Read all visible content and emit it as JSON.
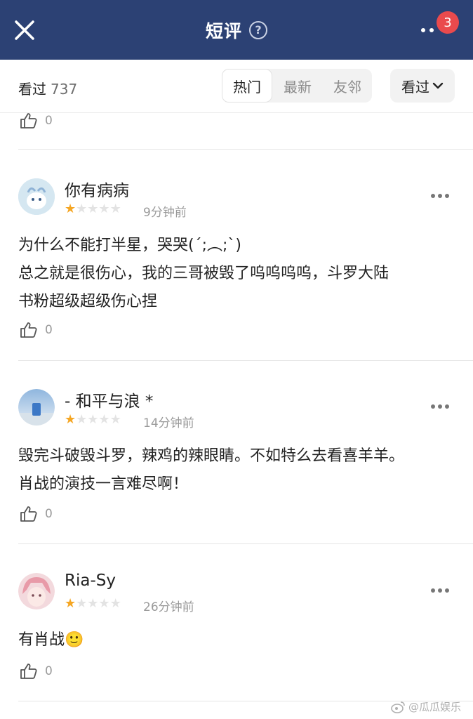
{
  "header": {
    "title": "短评",
    "help_icon": "question-circle-icon",
    "close_icon": "close-icon",
    "more_icon": "more-dots-icon",
    "badge_count": "3",
    "bar_color": "#2c4174",
    "badge_color": "#ea4a4d"
  },
  "filter": {
    "watched_label": "看过",
    "watched_count": "737",
    "tabs": [
      {
        "label": "热门",
        "active": true
      },
      {
        "label": "最新",
        "active": false
      },
      {
        "label": "友邻",
        "active": false
      }
    ],
    "dropdown_label": "看过"
  },
  "top_partial": {
    "like_count": "0"
  },
  "reviews": [
    {
      "username": "你有病病",
      "rating": 1,
      "max_rating": 5,
      "time": "9分钟前",
      "lines": [
        "为什么不能打半星，哭哭(´;︵;`)",
        "总之就是很伤心，我的三哥被毁了呜呜呜呜，斗罗大陆",
        "书粉超级超级伤心捏"
      ],
      "like_count": "0"
    },
    {
      "username": "- 和平与浪 *",
      "rating": 1,
      "max_rating": 5,
      "time": "14分钟前",
      "lines": [
        "毁完斗破毁斗罗，辣鸡的辣眼睛。不如特么去看喜羊羊。",
        "肖战的演技一言难尽啊！"
      ],
      "like_count": "0"
    },
    {
      "username": "Ria-Sy",
      "rating": 1,
      "max_rating": 5,
      "time": "26分钟前",
      "lines": [
        "有肖战🙂"
      ],
      "like_count": "0"
    }
  ],
  "star_colors": {
    "filled": "#f5a623",
    "empty": "#e3e3e3"
  },
  "watermark": "@瓜瓜娱乐"
}
